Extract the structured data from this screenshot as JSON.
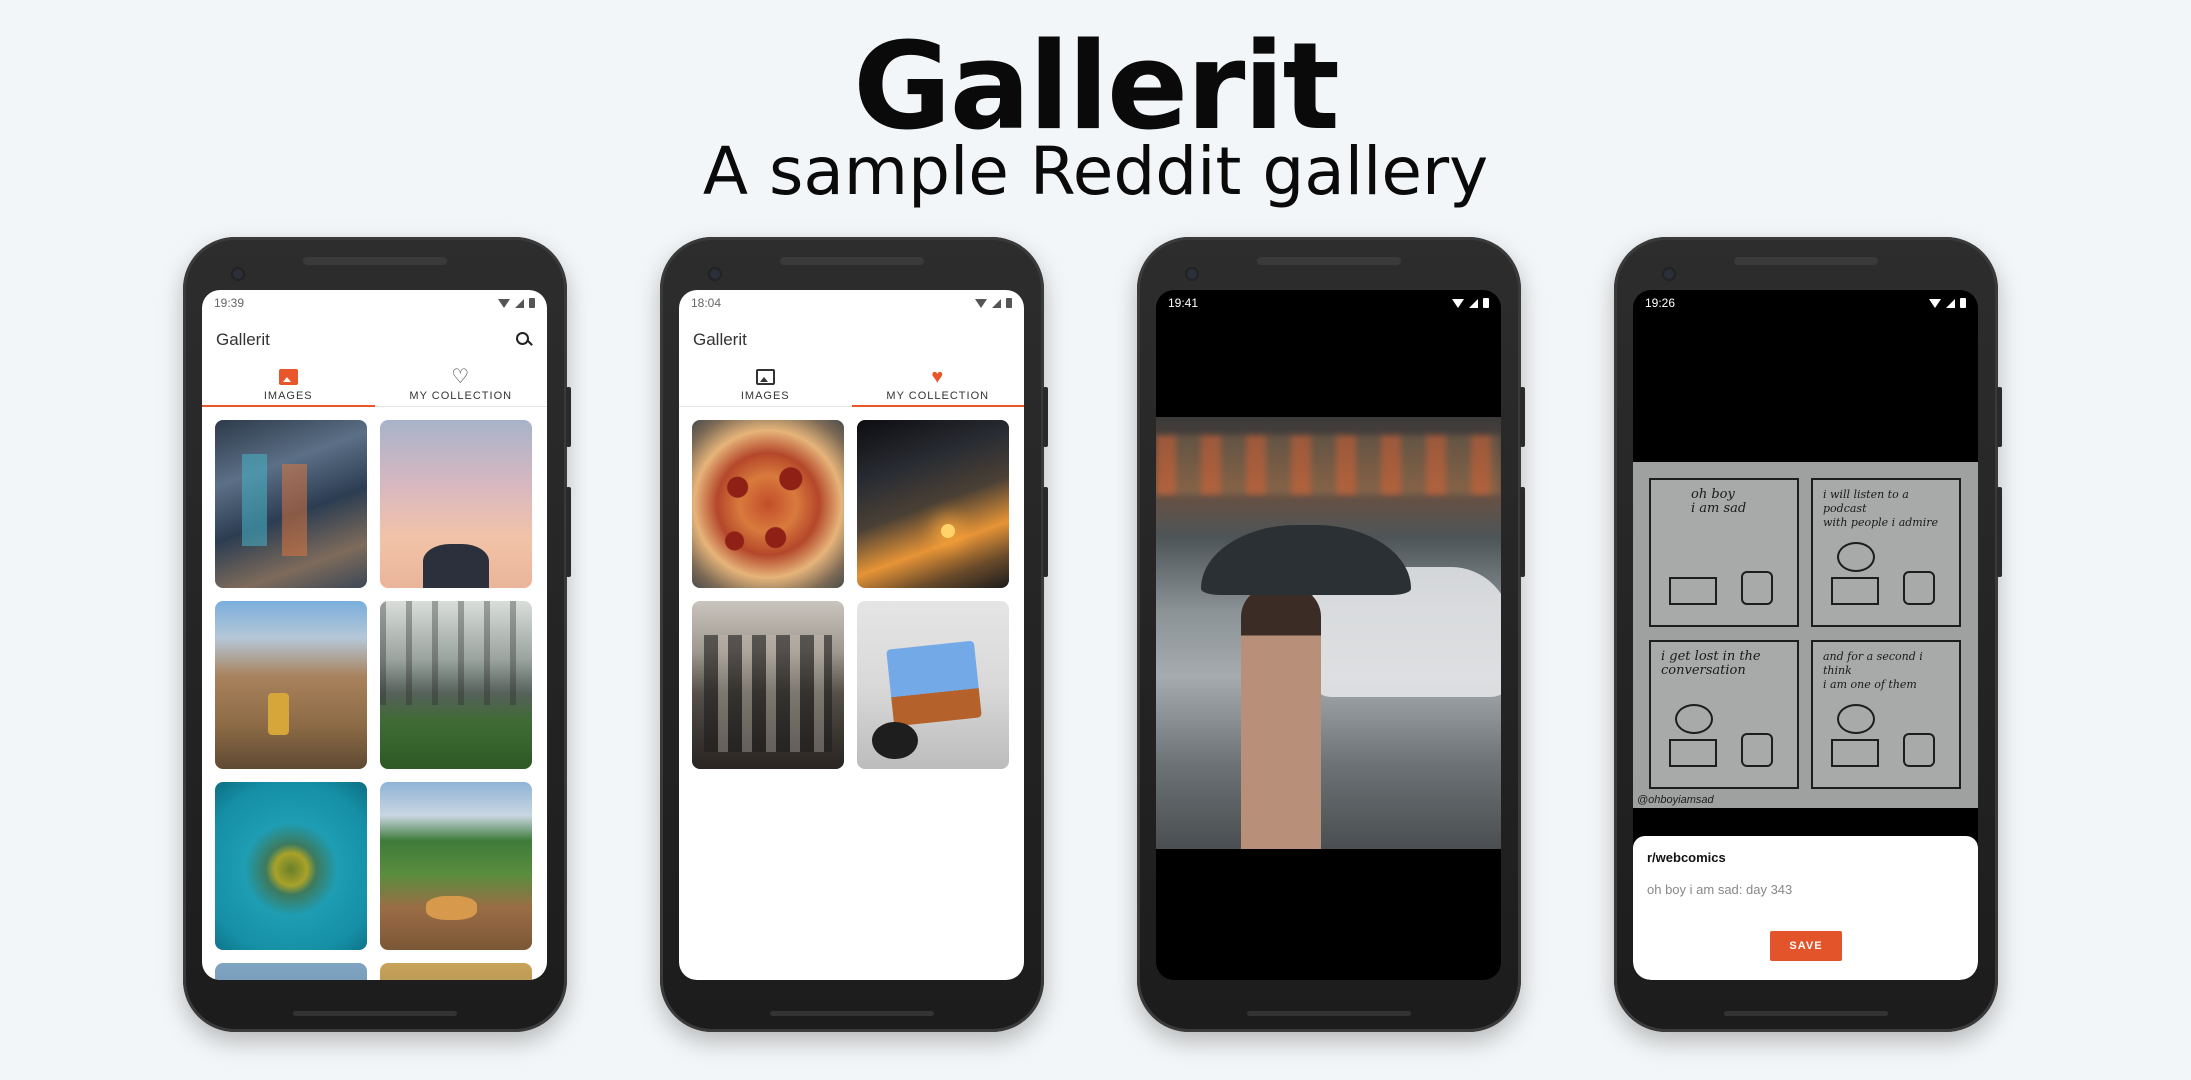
{
  "header": {
    "title": "Gallerit",
    "subtitle": "A sample Reddit gallery"
  },
  "phones": [
    {
      "status_time": "19:39",
      "app_title": "Gallerit",
      "tabs": [
        {
          "label": "IMAGES",
          "icon": "image-icon",
          "active": true
        },
        {
          "label": "MY COLLECTION",
          "icon": "heart-outline-icon",
          "active": false
        }
      ],
      "thumbnails": [
        "street-photo",
        "taj-mahal-photo",
        "town-photo",
        "forest-photo",
        "island-photo",
        "road-cat-photo",
        "more-photo-1",
        "more-photo-2"
      ]
    },
    {
      "status_time": "18:04",
      "app_title": "Gallerit",
      "tabs": [
        {
          "label": "IMAGES",
          "icon": "image-outline-icon",
          "active": false
        },
        {
          "label": "MY COLLECTION",
          "icon": "heart-filled-icon",
          "active": true
        }
      ],
      "thumbnails": [
        "pizza-photo",
        "wave-sunset-photo",
        "group-photo",
        "mario-canvas-photo"
      ]
    },
    {
      "status_time": "19:41",
      "image": "man-with-umbrella-photo"
    },
    {
      "status_time": "19:26",
      "comic": {
        "panels": [
          "oh boy\ni am sad",
          "i will listen to a podcast\nwith people i admire",
          "i get lost in the\nconversation",
          "and for a second i think\ni am one of them"
        ],
        "credit": "@ohboyiamsad"
      },
      "subreddit": "r/webcomics",
      "post_title": "oh boy i am sad: day 343",
      "save_label": "SAVE"
    }
  ],
  "colors": {
    "accent": "#e8562a",
    "background": "#f3f6f8"
  }
}
